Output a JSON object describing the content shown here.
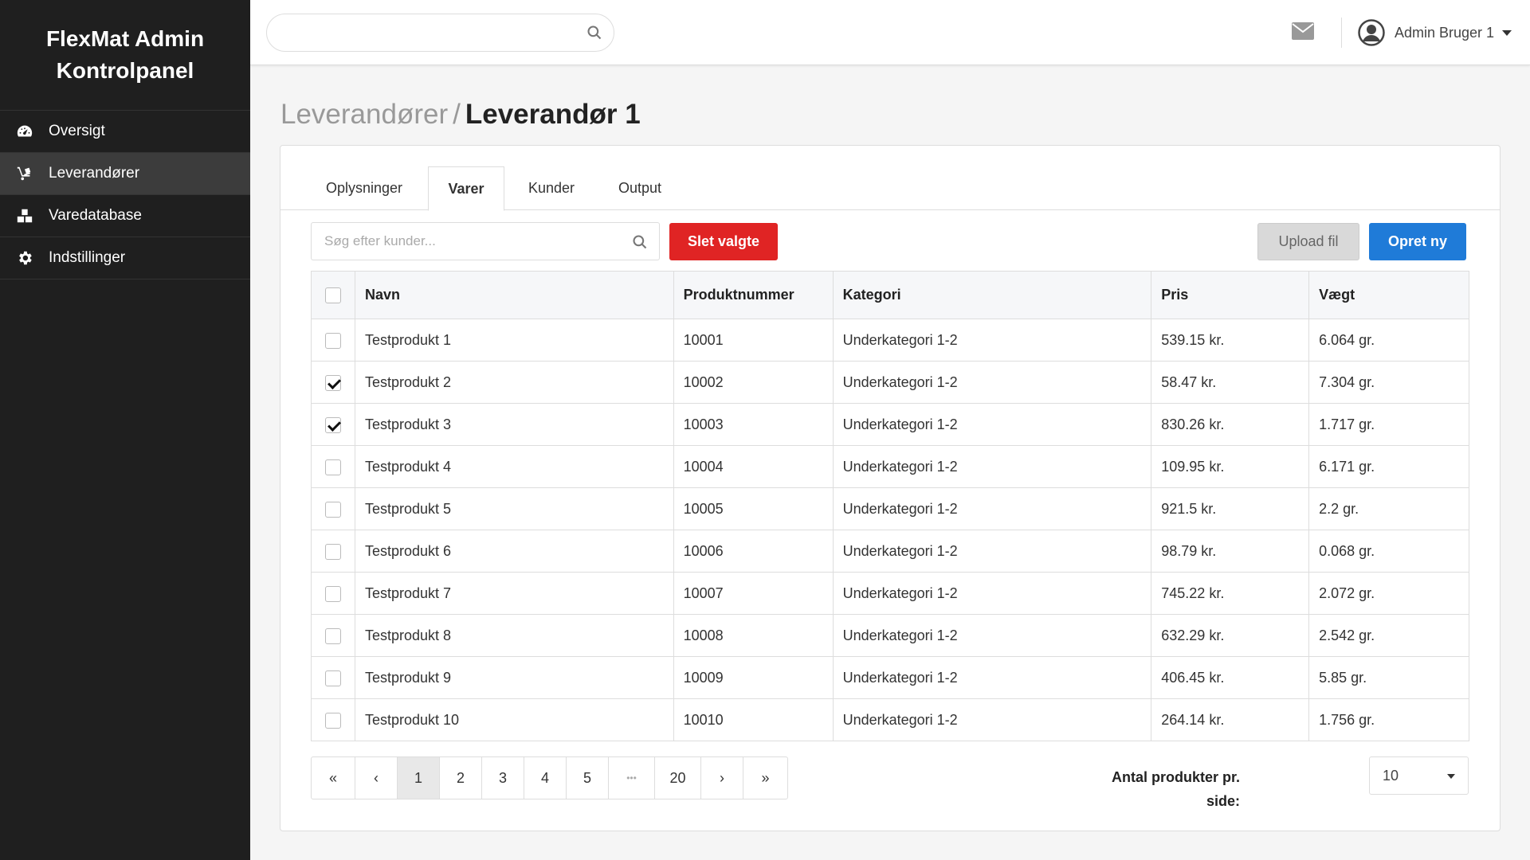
{
  "sidebar": {
    "brand_line1": "FlexMat Admin",
    "brand_line2": "Kontrolpanel",
    "items": [
      {
        "label": "Oversigt",
        "icon": "dashboard-icon",
        "active": false
      },
      {
        "label": "Leverandører",
        "icon": "dolly-icon",
        "active": true
      },
      {
        "label": "Varedatabase",
        "icon": "boxes-icon",
        "active": false
      },
      {
        "label": "Indstillinger",
        "icon": "gear-icon",
        "active": false
      }
    ]
  },
  "topbar": {
    "search_value": "",
    "user_name": "Admin Bruger 1"
  },
  "page": {
    "breadcrumb_parent": "Leverandører",
    "breadcrumb_separator": "/",
    "title": "Leverandør 1"
  },
  "tabs": [
    {
      "label": "Oplysninger",
      "active": false
    },
    {
      "label": "Varer",
      "active": true
    },
    {
      "label": "Kunder",
      "active": false
    },
    {
      "label": "Output",
      "active": false
    }
  ],
  "toolbar": {
    "search_placeholder": "Søg efter kunder...",
    "delete_label": "Slet valgte",
    "upload_label": "Upload fil",
    "create_label": "Opret ny"
  },
  "table": {
    "headers": [
      "Navn",
      "Produktnummer",
      "Kategori",
      "Pris",
      "Vægt"
    ],
    "rows": [
      {
        "checked": false,
        "name": "Testprodukt 1",
        "number": "10001",
        "category": "Underkategori 1-2",
        "price": "539.15 kr.",
        "weight": "6.064 gr."
      },
      {
        "checked": true,
        "name": "Testprodukt 2",
        "number": "10002",
        "category": "Underkategori 1-2",
        "price": "58.47 kr.",
        "weight": "7.304 gr."
      },
      {
        "checked": true,
        "name": "Testprodukt 3",
        "number": "10003",
        "category": "Underkategori 1-2",
        "price": "830.26 kr.",
        "weight": "1.717 gr."
      },
      {
        "checked": false,
        "name": "Testprodukt 4",
        "number": "10004",
        "category": "Underkategori 1-2",
        "price": "109.95 kr.",
        "weight": "6.171 gr."
      },
      {
        "checked": false,
        "name": "Testprodukt 5",
        "number": "10005",
        "category": "Underkategori 1-2",
        "price": "921.5 kr.",
        "weight": "2.2 gr."
      },
      {
        "checked": false,
        "name": "Testprodukt 6",
        "number": "10006",
        "category": "Underkategori 1-2",
        "price": "98.79 kr.",
        "weight": "0.068 gr."
      },
      {
        "checked": false,
        "name": "Testprodukt 7",
        "number": "10007",
        "category": "Underkategori 1-2",
        "price": "745.22 kr.",
        "weight": "2.072 gr."
      },
      {
        "checked": false,
        "name": "Testprodukt 8",
        "number": "10008",
        "category": "Underkategori 1-2",
        "price": "632.29 kr.",
        "weight": "2.542 gr."
      },
      {
        "checked": false,
        "name": "Testprodukt 9",
        "number": "10009",
        "category": "Underkategori 1-2",
        "price": "406.45 kr.",
        "weight": "5.85 gr."
      },
      {
        "checked": false,
        "name": "Testprodukt 10",
        "number": "10010",
        "category": "Underkategori 1-2",
        "price": "264.14 kr.",
        "weight": "1.756 gr."
      }
    ]
  },
  "pagination": {
    "first": "«",
    "prev": "‹",
    "pages": [
      "1",
      "2",
      "3",
      "4",
      "5"
    ],
    "ellipsis": "•••",
    "last_page": "20",
    "next": "›",
    "last": "»",
    "current": "1"
  },
  "per_page": {
    "label": "Antal produkter pr. side:",
    "value": "10"
  }
}
